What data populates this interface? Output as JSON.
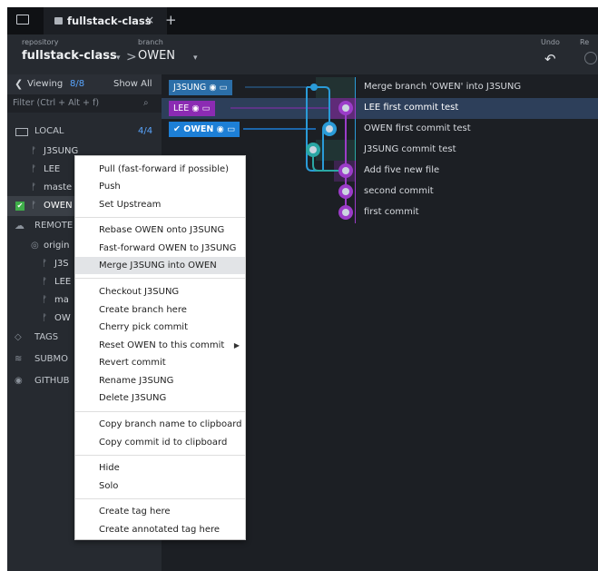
{
  "tabs": {
    "title": "fullstack-class",
    "close": "×",
    "new": "+"
  },
  "toolbar": {
    "repo_label": "repository",
    "repo_name": "fullstack-class",
    "branch_label": "branch",
    "branch_name": "OWEN",
    "undo_label": "Undo",
    "redo_label_partial": "Re",
    "separator": ">"
  },
  "left": {
    "viewing_label": "Viewing",
    "viewing_count": "8/8",
    "show_all": "Show All",
    "filter_placeholder": "Filter (Ctrl + Alt + f)",
    "local": {
      "label": "LOCAL",
      "count": "4/4"
    },
    "local_branches": [
      "J3SUNG",
      "LEE",
      "maste",
      "OWEN"
    ],
    "remote_label": "REMOTE",
    "origin_label": "origin",
    "remote_branches": [
      "J3S",
      "LEE",
      "ma",
      "OW"
    ],
    "tags_label": "TAGS",
    "submodules_label": "SUBMO",
    "github_label": "GITHUB"
  },
  "graph": {
    "branch_tags": [
      {
        "name": "J3SUNG",
        "color": "#2b6ea8"
      },
      {
        "name": "LEE",
        "color": "#8b2bb3"
      },
      {
        "name": "OWEN",
        "color": "#1d7fd6"
      }
    ],
    "commits": [
      "Merge branch 'OWEN' into J3SUNG",
      "LEE first commit test",
      "OWEN first commit test",
      "J3SUNG commit test",
      "Add five new file",
      "second commit",
      "first commit"
    ],
    "colors": {
      "blue": "#2a9bd8",
      "purple": "#9b3cc8",
      "teal": "#2aa7a4"
    }
  },
  "menu": {
    "group1": [
      "Pull (fast-forward if possible)",
      "Push",
      "Set Upstream"
    ],
    "group2": [
      "Rebase OWEN onto J3SUNG",
      "Fast-forward OWEN to J3SUNG",
      "Merge J3SUNG into OWEN"
    ],
    "group3": [
      "Checkout J3SUNG",
      "Create branch here",
      "Cherry pick commit",
      "Reset OWEN to this commit",
      "Revert commit",
      "Rename J3SUNG",
      "Delete J3SUNG"
    ],
    "group4": [
      "Copy branch name to clipboard",
      "Copy commit id to clipboard"
    ],
    "group5": [
      "Hide",
      "Solo"
    ],
    "group6": [
      "Create tag here",
      "Create annotated tag here"
    ]
  }
}
